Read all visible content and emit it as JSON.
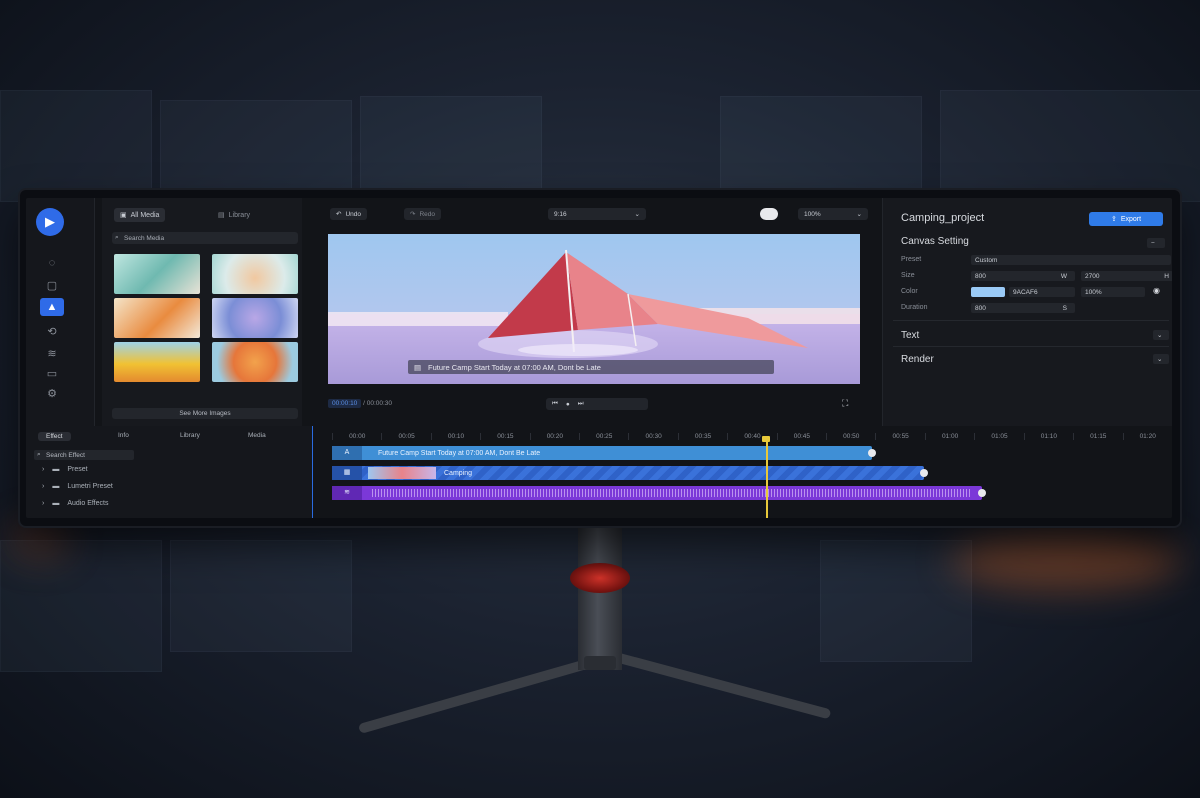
{
  "app": {
    "logo_icon": "video-camera-icon",
    "accent": "#2f6be8"
  },
  "media_panel": {
    "tab_all": "All Media",
    "tab_library": "Library",
    "search_placeholder": "Search Media",
    "see_more": "See More Images"
  },
  "toolbar": {
    "undo": "Undo",
    "redo": "Redo",
    "aspect": "9:16",
    "zoom": "100%"
  },
  "preview": {
    "caption": "Future Camp Start Today at 07:00 AM, Dont be Late",
    "time_current": "00:00:10",
    "time_total": "/ 00:00:30"
  },
  "properties": {
    "project_name": "Camping_project",
    "export_label": "Export",
    "canvas_setting": "Canvas Setting",
    "preset_label": "Preset",
    "preset_value": "Custom",
    "size_label": "Size",
    "width_value": "800",
    "width_unit": "W",
    "height_value": "2700",
    "height_unit": "H",
    "color_label": "Color",
    "color_value": "9ACAF6",
    "opacity_value": "100%",
    "duration_label": "Duration",
    "duration_value": "800",
    "duration_unit": "S",
    "text_section": "Text",
    "render_section": "Render"
  },
  "effects_panel": {
    "tabs": [
      "Effect",
      "Info",
      "Library",
      "Media"
    ],
    "search_placeholder": "Search Effect",
    "items": [
      "Preset",
      "Lumetri Preset",
      "Audio Effects"
    ]
  },
  "timeline": {
    "ruler": [
      "00:00",
      "00:05",
      "00:10",
      "00:15",
      "00:20",
      "00:25",
      "00:30",
      "00:35",
      "00:40",
      "00:45",
      "00:50",
      "00:55",
      "01:00",
      "01:05",
      "01:10",
      "01:15",
      "01:20"
    ],
    "text_track": "Future Camp Start Today at 07:00 AM, Dont Be Late",
    "video_track": "Camping",
    "text_track_icon": "A",
    "video_track_icon": "film-icon",
    "audio_track_icon": "audio-icon"
  }
}
